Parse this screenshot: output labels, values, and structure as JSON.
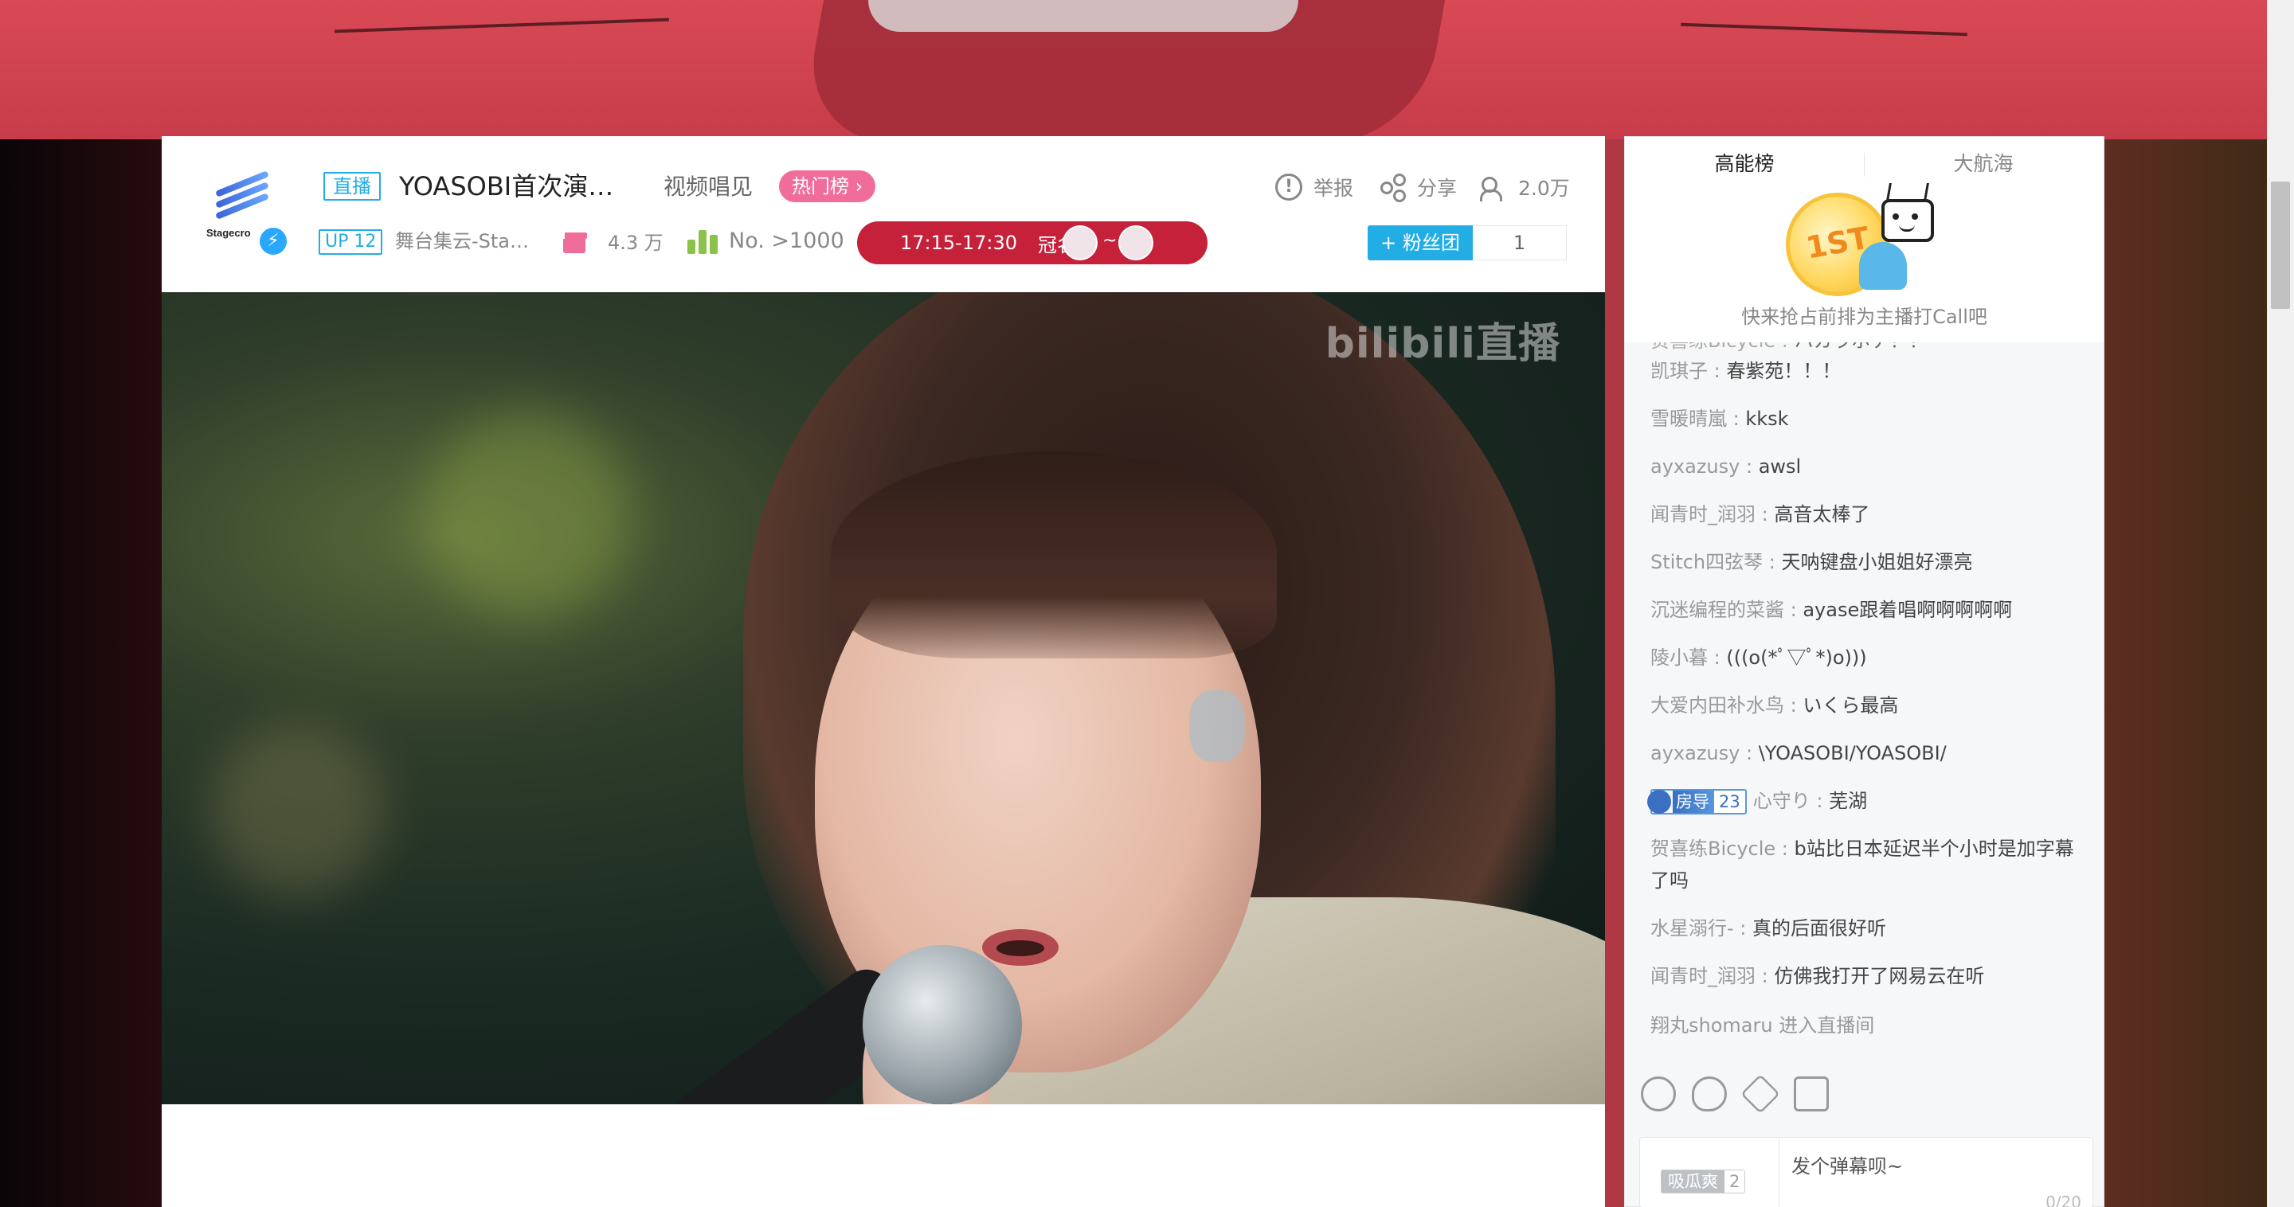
{
  "header": {
    "live_tag": "直播",
    "title": "YOASOBI首次演…",
    "area": "视频唱见",
    "hot_rank": "热门榜 ›",
    "report": "举报",
    "share": "分享",
    "watchers": "2.0万",
    "up_level": "UP 12",
    "uploader": "舞台集云-Sta…",
    "gift_count": "4.3 万",
    "rank_no": "No. >1000",
    "timeslot": "17:15-17:30",
    "sponsor_label": "冠名",
    "sponsor_sep": "~",
    "fan_button": "+ 粉丝团",
    "fan_count": "1",
    "avatar_text": "Stagecro"
  },
  "video": {
    "watermark": "bilibili直播"
  },
  "side": {
    "tab_active": "高能榜",
    "tab_other": "大航海",
    "first_badge": "1ST",
    "hint": "快来抢占前排为主播打Call吧",
    "chat": [
      {
        "user": "贺喜练Bicycle : ",
        "msg": "ハカラボチ！！"
      },
      {
        "user": "凯琪子 : ",
        "msg": "春紫苑！！！"
      },
      {
        "user": "雪暖晴嵐 : ",
        "msg": "kksk"
      },
      {
        "user": "ayxazusy : ",
        "msg": "awsl"
      },
      {
        "user": "闻青时_润羽 : ",
        "msg": "高音太棒了"
      },
      {
        "user": "Stitch四弦琴 : ",
        "msg": "天呐键盘小姐姐好漂亮"
      },
      {
        "user": "沉迷编程的菜酱 : ",
        "msg": "ayase跟着唱啊啊啊啊啊"
      },
      {
        "user": "陵小暮 : ",
        "msg": "(((o(*ﾟ▽ﾟ*)o)))"
      },
      {
        "user": "大爱内田补水鸟 : ",
        "msg": "いくら最高"
      },
      {
        "user": "ayxazusy : ",
        "msg": "\\YOASOBI/YOASOBI/"
      },
      {
        "user": "心守り : ",
        "msg": "芜湖",
        "medal_name": "房导",
        "medal_level": "23"
      },
      {
        "user": "贺喜练Bicycle : ",
        "msg": "b站比日本延迟半个小时是加字幕了吗"
      },
      {
        "user": "水星溺行- : ",
        "msg": "真的后面很好听"
      },
      {
        "user": "闻青时_润羽 : ",
        "msg": "仿佛我打开了网易云在听"
      },
      {
        "user": "翔丸shomaru ",
        "msg": "进入直播间"
      }
    ],
    "input_medal_name": "吸瓜爽",
    "input_medal_level": "2",
    "input_placeholder": "发个弹幕呗~",
    "input_count": "0/20"
  },
  "colors": {
    "accent": "#23ade5",
    "pink": "#f06c9a",
    "timeslot_bg": "#c5213a"
  }
}
